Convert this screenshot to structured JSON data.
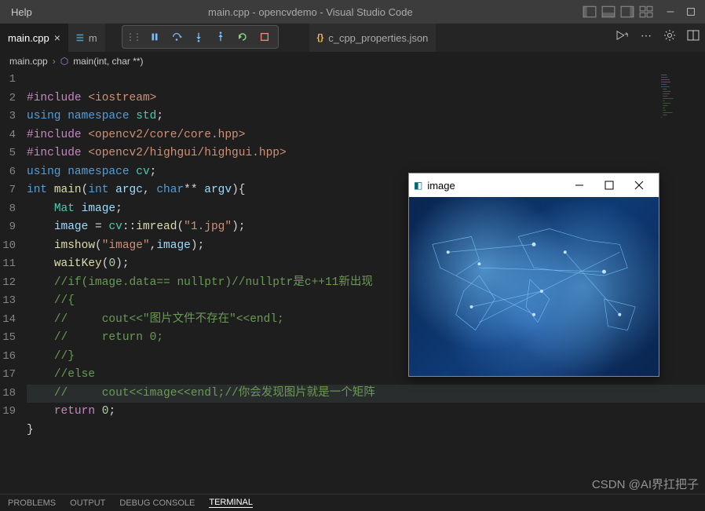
{
  "title_bar": {
    "menu_help": "Help",
    "title": "main.cpp - opencvdemo - Visual Studio Code"
  },
  "tabs": [
    {
      "label": "main.cpp",
      "active": true,
      "icon": "C"
    },
    {
      "label": "m",
      "active": false,
      "icon": "☰"
    },
    {
      "label": "c_cpp_properties.json",
      "active": false,
      "icon": "{}"
    }
  ],
  "breadcrumb": {
    "file": "main.cpp",
    "symbol": "main(int, char **)"
  },
  "gutter_start": 1,
  "image_window": {
    "title": "image"
  },
  "code": {
    "l1": {
      "a": "#include ",
      "b": "<iostream>"
    },
    "l2": {
      "a": "using ",
      "b": "namespace",
      "c": " std",
      "d": ";"
    },
    "l3": {
      "a": "#include ",
      "b": "<opencv2/core/core.hpp>"
    },
    "l4": {
      "a": "#include ",
      "b": "<opencv2/highgui/highgui.hpp>"
    },
    "l5": {
      "a": "using ",
      "b": "namespace",
      "c": " cv",
      "d": ";"
    },
    "l6": {
      "a": "int ",
      "b": "main",
      "c": "(",
      "d": "int ",
      "e": "argc",
      "f": ", ",
      "g": "char",
      "h": "** ",
      "i": "argv",
      "j": "){"
    },
    "l7": {
      "a": "    ",
      "b": "Mat ",
      "c": "image",
      "d": ";"
    },
    "l8": {
      "a": "    ",
      "b": "image ",
      "c": "= ",
      "d": "cv",
      "e": "::",
      "f": "imread",
      "g": "(",
      "h": "\"1.jpg\"",
      "i": ");"
    },
    "l9": {
      "a": "    ",
      "b": "imshow",
      "c": "(",
      "d": "\"image\"",
      "e": ",",
      "f": "image",
      "g": ");"
    },
    "l10": {
      "a": "    ",
      "b": "waitKey",
      "c": "(",
      "d": "0",
      "e": ");"
    },
    "l11": {
      "a": "    ",
      "b": "//if(image.data== nullptr)//nullptr是c++11新出现"
    },
    "l12": {
      "a": "    ",
      "b": "//{"
    },
    "l13": {
      "a": "    ",
      "b": "//     cout<<\"图片文件不存在\"<<endl;"
    },
    "l14": {
      "a": "    ",
      "b": "//     return 0;"
    },
    "l15": {
      "a": "    ",
      "b": "//}"
    },
    "l16": {
      "a": "    ",
      "b": "//else"
    },
    "l17": {
      "a": "    ",
      "b": "//     cout<<image<<endl;//你会发现图片就是一个矩阵"
    },
    "l18": {
      "a": "    ",
      "b": "return ",
      "c": "0",
      "d": ";"
    },
    "l19": {
      "a": "}"
    }
  },
  "bottom_tabs": {
    "problems": "PROBLEMS",
    "output": "OUTPUT",
    "debug": "DEBUG CONSOLE",
    "terminal": "TERMINAL"
  },
  "watermark": "CSDN @AI界扛把子"
}
